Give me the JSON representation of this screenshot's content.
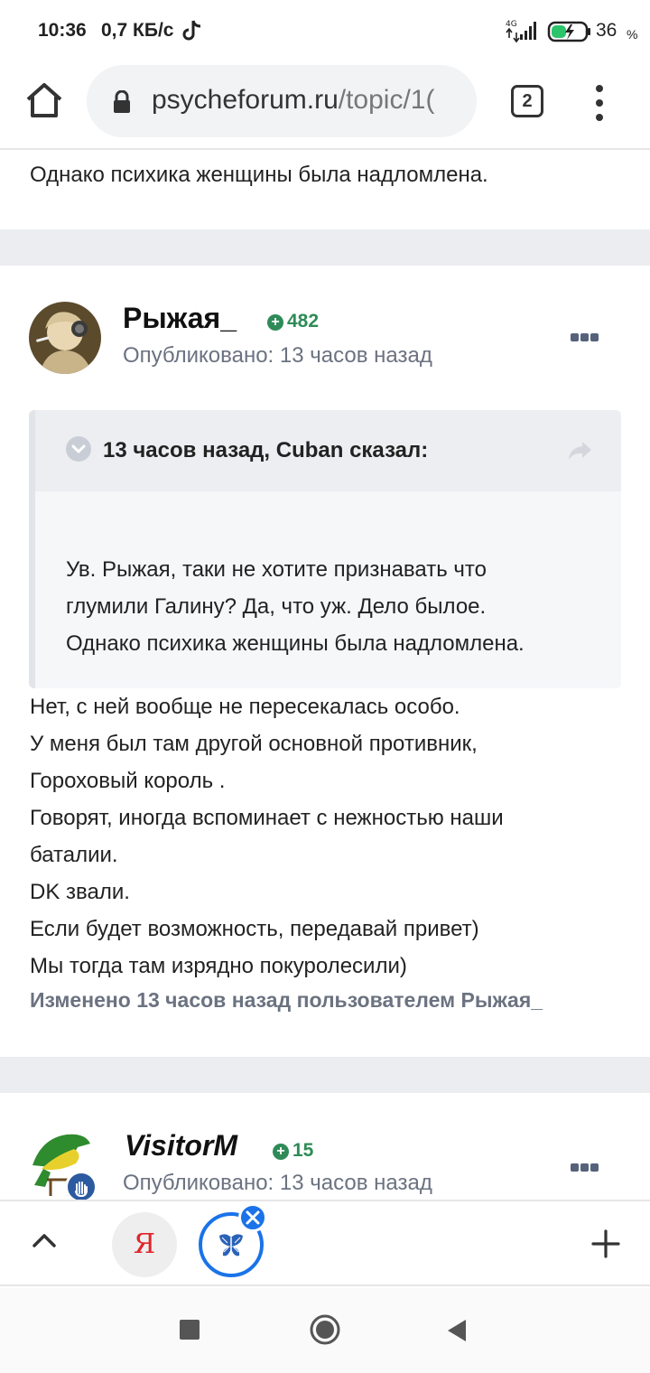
{
  "status_bar": {
    "time": "10:36",
    "speed": "0,7 КБ/с",
    "network": "4G",
    "battery": "36",
    "battery_unit": "%"
  },
  "browser": {
    "url_host": "psycheforum.ru",
    "url_path": "/topic/1(",
    "tab_count": "2"
  },
  "top_card": {
    "text": "Однако психика женщины была надломлена."
  },
  "post": {
    "author": "Рыжая_",
    "reputation": "482",
    "posted": "Опубликовано: 13 часов назад",
    "quote": {
      "title": "13 часов назад, Cuban сказал:",
      "lines": [
        "Ув. Рыжая, таки не хотите признавать что",
        "глумили Галину? Да, что уж. Дело былое.",
        "Однако психика женщины была надломлена."
      ]
    },
    "lines": [
      "Нет, с ней вообще не пересекалась особо.",
      "У меня был там другой основной противник,",
      "Гороховый король .",
      "Говорят, иногда вспоминает с нежностью наши",
      "баталии.",
      "DK звали.",
      "Если будет возможность, передавай привет)",
      "Мы тогда там изрядно покуролесили)"
    ],
    "edited": "Изменено 13 часов назад пользователем Рыжая_"
  },
  "next_post": {
    "author": "VisitorM",
    "reputation": "15",
    "posted": "Опубликовано: 13 часов назад"
  },
  "tab_strip": {
    "yandex_letter": "Я"
  },
  "colors": {
    "accent": "#1a73e8",
    "reputation": "#2e8b57",
    "muted": "#6b7280",
    "page_bg": "#ebedf0"
  }
}
